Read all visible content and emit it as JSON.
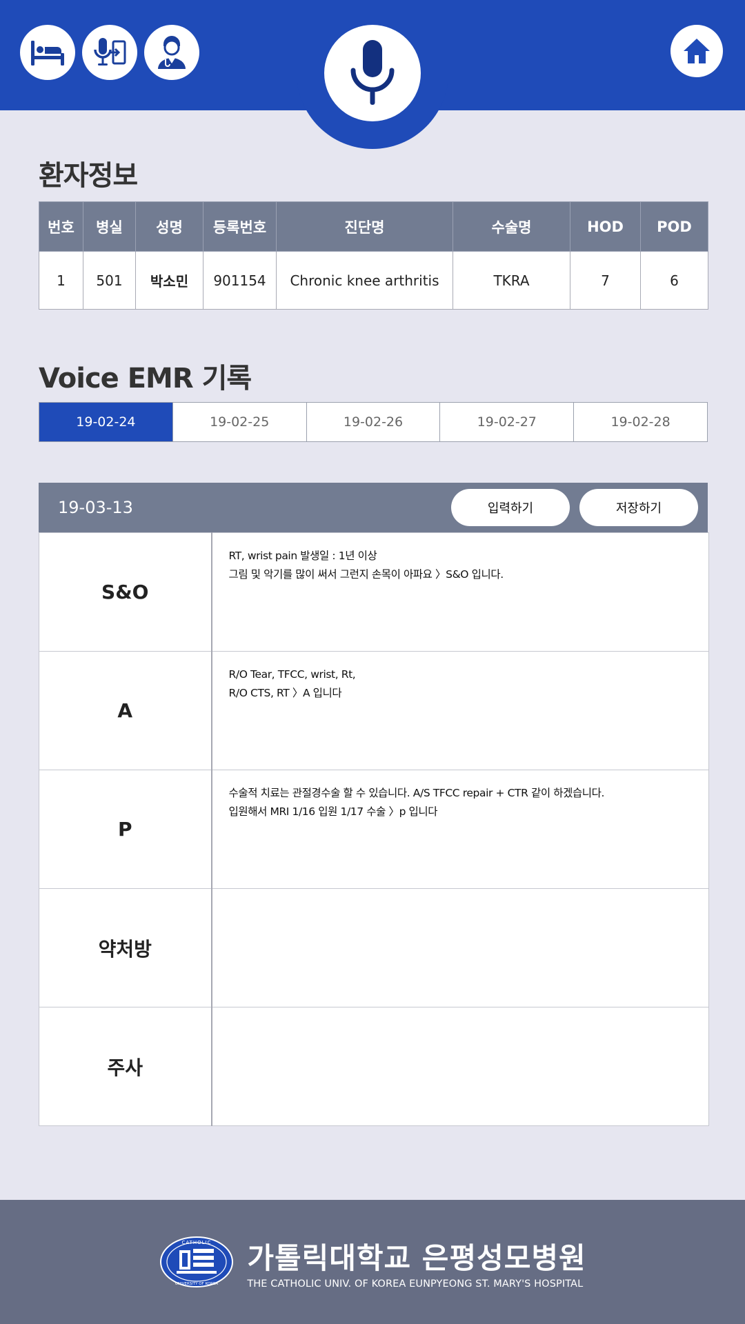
{
  "header": {
    "icons": [
      "hospital-bed-icon",
      "voice-transfer-icon",
      "doctor-icon",
      "microphone-icon",
      "home-icon"
    ],
    "colors": {
      "primary": "#1f4bb8",
      "table_header": "#727c92",
      "background": "#e6e6f0",
      "footer": "#666d84"
    }
  },
  "patient_section": {
    "title": "환자정보",
    "columns": [
      "번호",
      "병실",
      "성명",
      "등록번호",
      "진단명",
      "수술명",
      "HOD",
      "POD"
    ],
    "rows": [
      [
        "1",
        "501",
        "박소민",
        "901154",
        "Chronic knee arthritis",
        "TKRA",
        "7",
        "6"
      ]
    ]
  },
  "emr_section": {
    "title": "Voice EMR 기록",
    "dates": [
      "19-02-24",
      "19-02-25",
      "19-02-26",
      "19-02-27",
      "19-02-28"
    ],
    "active_date": "19-02-24"
  },
  "record": {
    "date": "19-03-13",
    "input_button": "입력하기",
    "save_button": "저장하기",
    "rows": [
      {
        "label": "S&O",
        "lines": [
          "RT, wrist pain 발생일 : 1년 이상",
          "그림 및 악기를 많이 써서 그런지 손목이 아파요 〉S&O 입니다."
        ]
      },
      {
        "label": "A",
        "lines": [
          "R/O Tear, TFCC, wrist, Rt,",
          "R/O CTS, RT 〉A 입니다"
        ]
      },
      {
        "label": "P",
        "lines": [
          "수술적 치료는 관절경수술 할 수 있습니다. A/S TFCC repair + CTR 같이 하겠습니다.",
          "입원해서 MRI 1/16 입원 1/17 수술 〉p 입니다"
        ]
      },
      {
        "label": "약처방",
        "lines": [
          "",
          ""
        ]
      },
      {
        "label": "주사",
        "lines": [
          "",
          ""
        ]
      }
    ]
  },
  "footer": {
    "logo_text_top": "CATHOLIC",
    "logo_text_bottom": "UNIVERSITY OF KOREA",
    "name": "가톨릭대학교 은평성모병원",
    "subtitle": "THE CATHOLIC UNIV. OF KOREA EUNPYEONG ST. MARY'S HOSPITAL"
  }
}
